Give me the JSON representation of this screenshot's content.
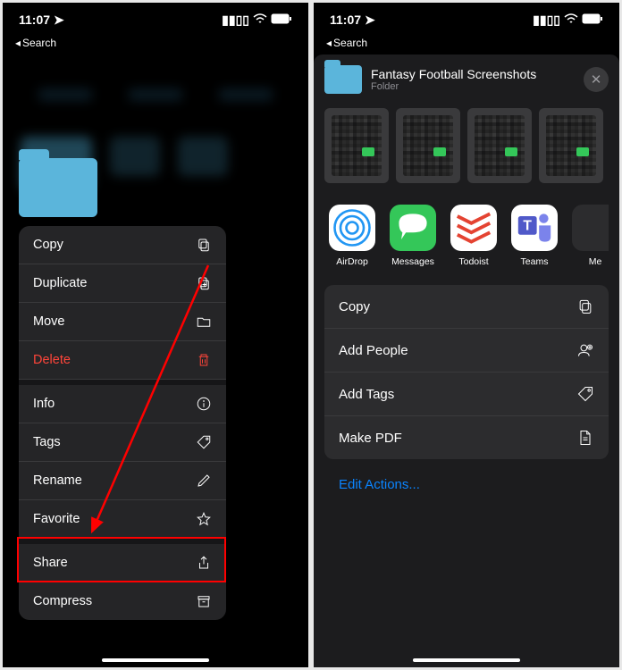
{
  "status": {
    "time": "11:07",
    "back_label": "Search"
  },
  "left": {
    "menu": [
      {
        "label": "Copy",
        "icon": "copy-icon"
      },
      {
        "label": "Duplicate",
        "icon": "duplicate-icon"
      },
      {
        "label": "Move",
        "icon": "folder-icon"
      },
      {
        "label": "Delete",
        "icon": "trash-icon",
        "danger": true
      },
      {
        "label": "Info",
        "icon": "info-icon",
        "sep": true
      },
      {
        "label": "Tags",
        "icon": "tag-icon"
      },
      {
        "label": "Rename",
        "icon": "pencil-icon"
      },
      {
        "label": "Favorite",
        "icon": "star-icon"
      },
      {
        "label": "Share",
        "icon": "share-icon",
        "sep": true,
        "highlighted": true
      },
      {
        "label": "Compress",
        "icon": "archive-icon"
      }
    ]
  },
  "right": {
    "sheet_title": "Fantasy Football Screenshots",
    "sheet_subtitle": "Folder",
    "apps": [
      {
        "label": "AirDrop",
        "icon": "airdrop"
      },
      {
        "label": "Messages",
        "icon": "messages"
      },
      {
        "label": "Todoist",
        "icon": "todoist"
      },
      {
        "label": "Teams",
        "icon": "teams"
      },
      {
        "label": "Me",
        "icon": "more"
      }
    ],
    "actions": [
      {
        "label": "Copy",
        "icon": "copy-icon"
      },
      {
        "label": "Add People",
        "icon": "person-add-icon"
      },
      {
        "label": "Add Tags",
        "icon": "tag-icon"
      },
      {
        "label": "Make PDF",
        "icon": "doc-icon"
      }
    ],
    "edit_actions": "Edit Actions..."
  }
}
